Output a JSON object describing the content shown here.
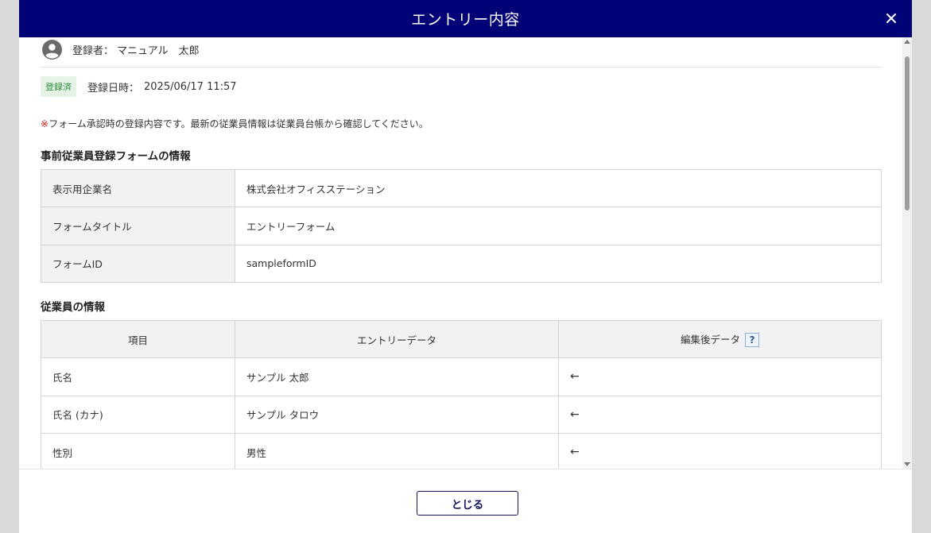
{
  "modal": {
    "title": "エントリー内容",
    "close_icon": "close-icon"
  },
  "registrant": {
    "label": "登録者：",
    "name": "マニュアル　太郎",
    "icon": "user-avatar-icon"
  },
  "status": {
    "badge": "登録済",
    "label": "登録日時：",
    "datetime": "2025/06/17 11:57",
    "badge_color": "#2f8a3d"
  },
  "note": {
    "mark": "※",
    "text": "フォーム承認時の登録内容です。最新の従業員情報は従業員台帳から確認してください。"
  },
  "form_section": {
    "title": "事前従業員登録フォームの情報",
    "rows": [
      {
        "label": "表示用企業名",
        "value": "株式会社オフィスステーション"
      },
      {
        "label": "フォームタイトル",
        "value": "エントリーフォーム"
      },
      {
        "label": "フォームID",
        "value": "sampleformID"
      }
    ]
  },
  "employee_section": {
    "title": "従業員の情報",
    "headers": {
      "item": "項目",
      "entry": "エントリーデータ",
      "edited": "編集後データ",
      "help": "?"
    },
    "rows": [
      {
        "item": "氏名",
        "entry": "サンプル 太郎",
        "edited": "←"
      },
      {
        "item": "氏名 (カナ)",
        "entry": "サンプル タロウ",
        "edited": "←"
      },
      {
        "item": "性別",
        "entry": "男性",
        "edited": "←"
      }
    ]
  },
  "footer": {
    "close_label": "とじる"
  },
  "colors": {
    "header_bg": "#020277",
    "accent": "#14145c",
    "note_mark": "#d81e1e"
  }
}
